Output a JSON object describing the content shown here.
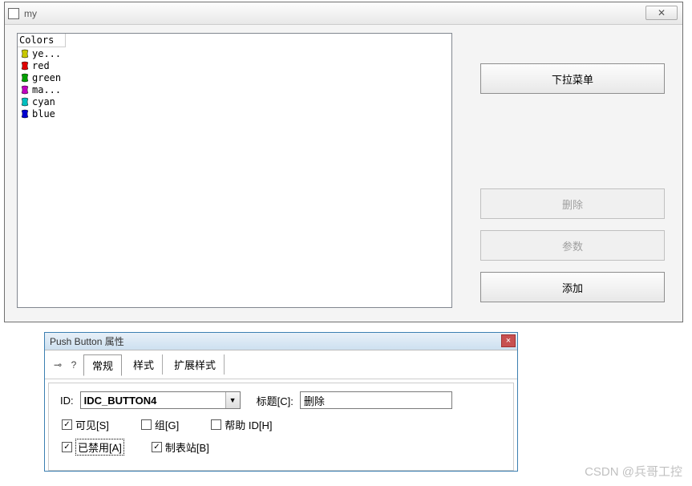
{
  "main_window": {
    "title": "my",
    "close_symbol": "✕",
    "list_header": "Colors",
    "items": [
      {
        "label": "ye...",
        "color": "#c8c800"
      },
      {
        "label": "red",
        "color": "#e00000"
      },
      {
        "label": "green",
        "color": "#00a000"
      },
      {
        "label": "ma...",
        "color": "#c000c0"
      },
      {
        "label": "cyan",
        "color": "#00c0c0"
      },
      {
        "label": "blue",
        "color": "#0000d0"
      }
    ],
    "buttons": {
      "dropdown": "下拉菜单",
      "delete": "删除",
      "params": "参数",
      "add": "添加"
    }
  },
  "props_dialog": {
    "title": "Push Button 属性",
    "close_symbol": "×",
    "tabs": {
      "general": "常规",
      "style": "样式",
      "ext_style": "扩展样式"
    },
    "id_label": "ID:",
    "id_value": "IDC_BUTTON4",
    "caption_label": "标题[C]:",
    "caption_value": "删除",
    "checks": {
      "visible": "可见[S]",
      "group": "组[G]",
      "helpid": "帮助 ID[H]",
      "disabled": "已禁用[A]",
      "tabstop": "制表站[B]"
    }
  },
  "watermark": "CSDN @兵哥工控"
}
